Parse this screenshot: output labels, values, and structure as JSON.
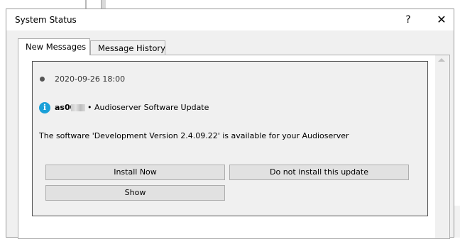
{
  "dialog": {
    "title": "System Status",
    "help_glyph": "?",
    "close_glyph": "✕"
  },
  "tabs": [
    {
      "label": "New Messages",
      "active": true
    },
    {
      "label": "Message History",
      "active": false
    }
  ],
  "message": {
    "date": "2020-09-26 18:00",
    "sender_prefix": "as00",
    "subject": "• Audioserver Software Update",
    "body": "The software 'Development Version 2.4.09.22' is available for your Audioserver",
    "info_icon_glyph": "i",
    "info_icon_color": "#1aa0d8"
  },
  "buttons": {
    "install": "Install Now",
    "skip": "Do not install this update",
    "show": "Show"
  }
}
